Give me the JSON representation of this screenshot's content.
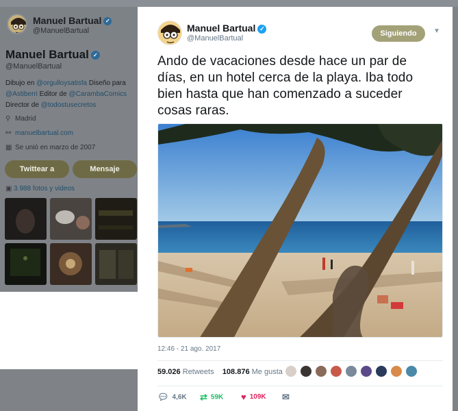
{
  "profile": {
    "display_name": "Manuel Bartual",
    "handle": "@ManuelBartual",
    "bio_prefix": "Dibujo en ",
    "bio_link1": "@orgulloysatisfa",
    "bio_mid1": " Diseño para ",
    "bio_link2": "@Astiberri",
    "bio_mid2": " Editor de ",
    "bio_link3": "@CarambaComics",
    "bio_mid3": " Director de ",
    "bio_link4": "@todostusecretos",
    "location": "Madrid",
    "website": "manuelbartual.com",
    "joined": "Se unió en marzo de 2007",
    "tweet_to_label": "Twittear a",
    "message_label": "Mensaje",
    "photos_label": "3.988 fotos y videos"
  },
  "tweet": {
    "author_name": "Manuel Bartual",
    "author_handle": "@ManuelBartual",
    "follow_label": "Siguiendo",
    "text": "Ando de vacaciones desde hace un par de días, en un hotel cerca de la playa. Iba todo bien hasta que han comenzado a suceder cosas raras.",
    "timestamp": "12:46 - 21 ago. 2017",
    "retweets_count": "59.026",
    "retweets_label": "Retweets",
    "likes_count": "108.876",
    "likes_label": "Me gusta",
    "reply_count": "4,6K",
    "retweet_action_count": "59K",
    "like_action_count": "109K"
  },
  "icons": {
    "verified": "verified-badge-icon",
    "reply": "reply-icon",
    "retweet": "retweet-icon",
    "like": "heart-icon",
    "dm": "envelope-icon",
    "caret": "chevron-down-icon",
    "location": "location-pin-icon",
    "link": "link-icon",
    "calendar": "calendar-icon",
    "photos": "photo-icon"
  },
  "colors": {
    "follow_button": "#a3a178",
    "retweet_green": "#17bf63",
    "like_red": "#e0245e",
    "link_blue": "#1da1f2"
  }
}
